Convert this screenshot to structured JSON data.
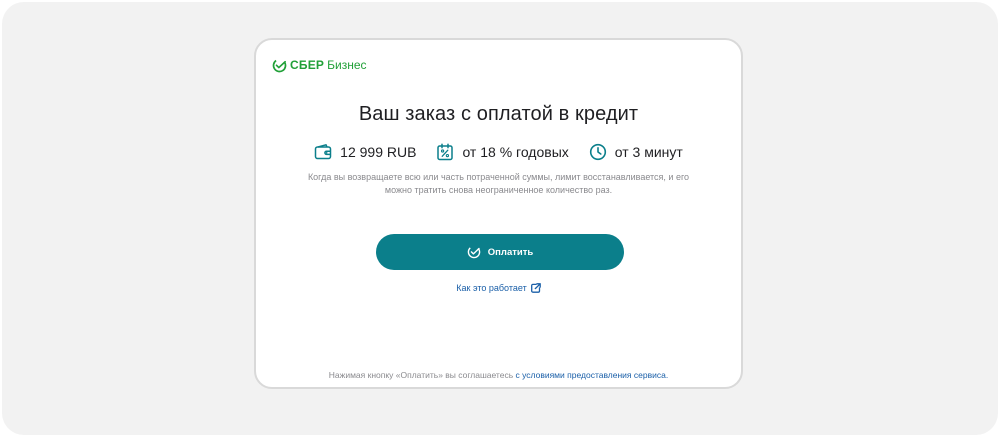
{
  "brand": {
    "name_bold": "СБЕР",
    "name_regular": "Бизнес",
    "color": "#21a038"
  },
  "title": "Ваш заказ с оплатой в кредит",
  "features": [
    {
      "icon": "wallet-icon",
      "text": "12 999 RUB"
    },
    {
      "icon": "calendar-percent-icon",
      "text": "от 18 % годовых"
    },
    {
      "icon": "clock-icon",
      "text": "от 3 минут"
    }
  ],
  "description": "Когда вы возвращаете всю или часть потраченной суммы, лимит восстанавливается, и его можно тратить снова неограниченное количество раз.",
  "pay_button": {
    "label": "Оплатить",
    "icon": "check-circle-icon",
    "color": "#0b7f8b"
  },
  "how_link": {
    "label": "Как это работает",
    "icon": "external-link-icon"
  },
  "footer": {
    "text": "Нажимая кнопку «Оплатить» вы соглашаетесь",
    "link": "с условиями предоставления сервиса."
  },
  "colors": {
    "accent": "#0b7f8b",
    "link": "#1a5fa8",
    "muted_text": "#8a8a8e"
  }
}
